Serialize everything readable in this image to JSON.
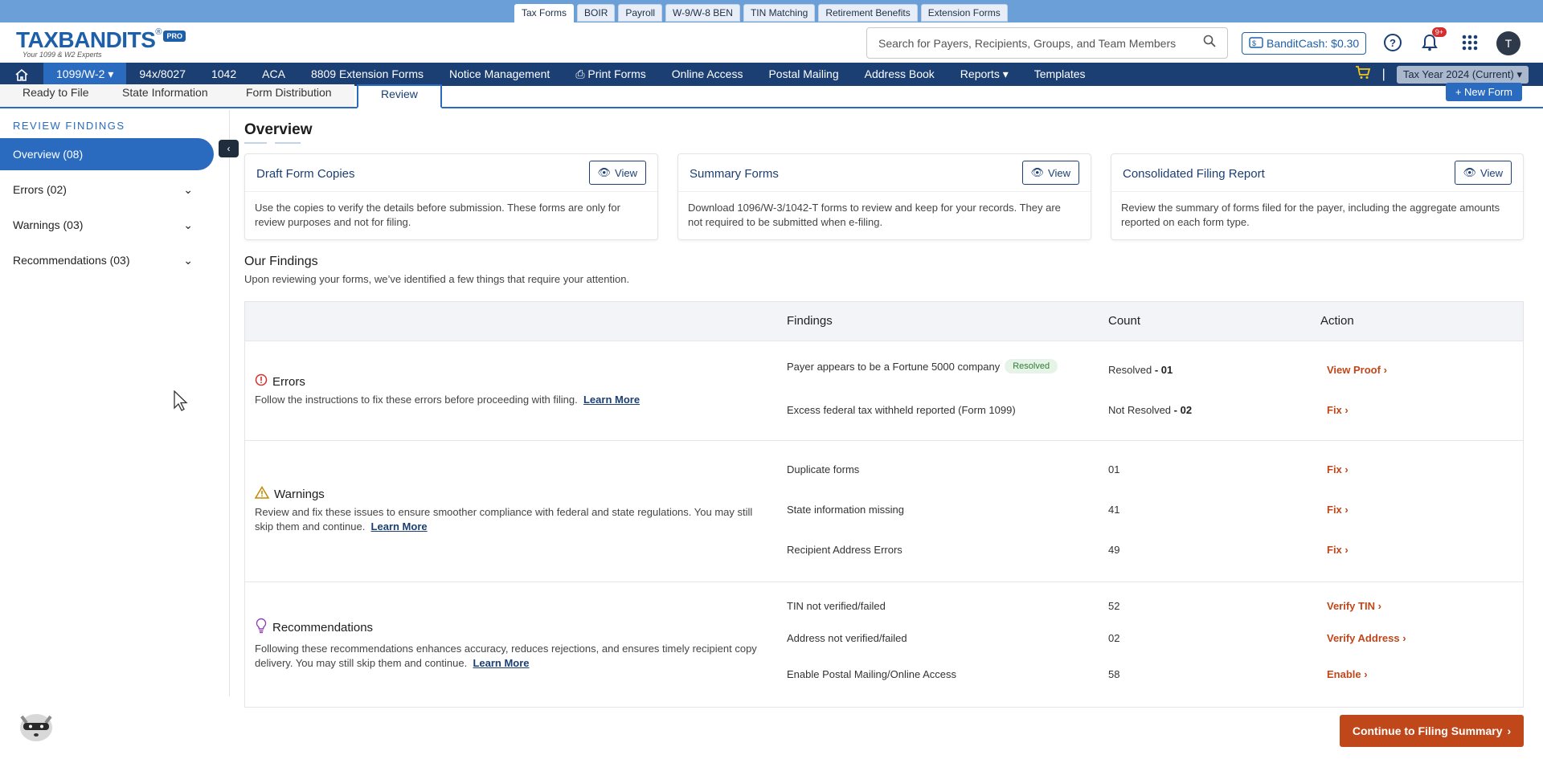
{
  "top_tabs": [
    "Tax Forms",
    "BOIR",
    "Payroll",
    "W-9/W-8 BEN",
    "TIN Matching",
    "Retirement Benefits",
    "Extension Forms"
  ],
  "logo": {
    "brand": "TAXBANDITS",
    "reg": "®",
    "pro": "PRO",
    "tagline": "Your 1099 & W2 Experts"
  },
  "search": {
    "placeholder": "Search for Payers, Recipients, Groups, and Team Members"
  },
  "header": {
    "bandit_cash": "BanditCash: $0.30",
    "notification_count": "9+",
    "avatar_initial": "T"
  },
  "nav": {
    "items": [
      "1099/W-2",
      "94x/8027",
      "1042",
      "ACA",
      "8809 Extension Forms",
      "Notice Management",
      "Print Forms",
      "Online Access",
      "Postal Mailing",
      "Address Book",
      "Reports",
      "Templates"
    ],
    "tax_year": "Tax Year 2024 (Current)"
  },
  "subtabs": [
    "Ready to File",
    "State Information",
    "Form Distribution",
    "Review"
  ],
  "new_form": "+ New Form",
  "sidebar": {
    "title": "REVIEW FINDINGS",
    "items": [
      "Overview (08)",
      "Errors (02)",
      "Warnings (03)",
      "Recommendations (03)"
    ]
  },
  "overview": {
    "title": "Overview",
    "cards": [
      {
        "title": "Draft Form Copies",
        "button": "View",
        "text": "Use the copies to verify the details before submission. These forms are only for review purposes and not for filing."
      },
      {
        "title": "Summary Forms",
        "button": "View",
        "text": "Download 1096/W-3/1042-T forms to review and keep for your records. They are not required to be submitted when e-filing."
      },
      {
        "title": "Consolidated Filing Report",
        "button": "View",
        "text": "Review the summary of forms filed for the payer, including the aggregate amounts reported on each form type."
      }
    ]
  },
  "findings": {
    "title": "Our Findings",
    "subtitle": "Upon reviewing your forms, we’ve identified a few things that require your attention.",
    "headers": {
      "findings": "Findings",
      "count": "Count",
      "action": "Action"
    },
    "errors": {
      "title": "Errors",
      "desc": "Follow the instructions to fix these errors before proceeding with filing.",
      "learn": "Learn More",
      "rows": [
        {
          "finding": "Payer appears to be a Fortune 5000 company",
          "badge": "Resolved",
          "count_label": "Resolved",
          "count": "- 01",
          "action": "View Proof"
        },
        {
          "finding": "Excess federal tax withheld reported (Form 1099)",
          "count_label": "Not Resolved",
          "count": "- 02",
          "action": "Fix"
        }
      ]
    },
    "warnings": {
      "title": "Warnings",
      "desc": "Review and fix these issues to ensure smoother compliance with federal and state regulations. You may still skip them and continue.",
      "learn": "Learn More",
      "rows": [
        {
          "finding": "Duplicate forms",
          "count": "01",
          "action": "Fix"
        },
        {
          "finding": "State information missing",
          "count": "41",
          "action": "Fix"
        },
        {
          "finding": "Recipient Address Errors",
          "count": "49",
          "action": "Fix"
        }
      ]
    },
    "recommendations": {
      "title": "Recommendations",
      "desc": "Following these recommendations enhances accuracy, reduces rejections, and ensures timely recipient copy delivery. You may still skip them and continue.",
      "learn": "Learn More",
      "rows": [
        {
          "finding": "TIN not verified/failed",
          "count": "52",
          "action": "Verify TIN"
        },
        {
          "finding": "Address not verified/failed",
          "count": "02",
          "action": "Verify Address"
        },
        {
          "finding": "Enable Postal Mailing/Online Access",
          "count": "58",
          "action": "Enable"
        }
      ]
    }
  },
  "continue_button": "Continue to Filing Summary",
  "colors": {
    "nav_bg": "#1b3f73",
    "accent": "#2a6bbf",
    "action": "#c0471a",
    "resolved": "#2e7d32"
  }
}
